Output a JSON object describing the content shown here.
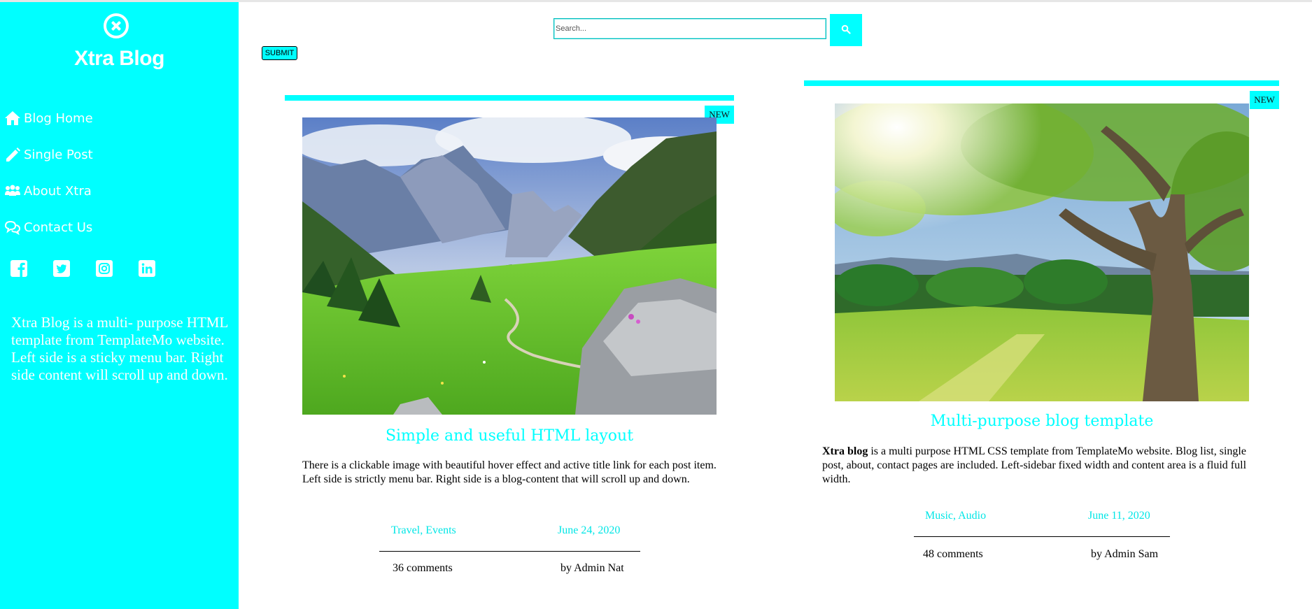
{
  "sidebar": {
    "brand": "Xtra Blog",
    "nav": [
      {
        "label": "Blog Home",
        "icon": "home-icon"
      },
      {
        "label": "Single Post",
        "icon": "pencil-icon"
      },
      {
        "label": "About Xtra",
        "icon": "users-icon"
      },
      {
        "label": "Contact Us",
        "icon": "comments-icon"
      }
    ],
    "social": [
      "facebook-icon",
      "twitter-icon",
      "instagram-icon",
      "linkedin-icon"
    ],
    "description": "Xtra Blog is a multi- purpose HTML template from TemplateMo website. Left side is a sticky menu bar. Right side content will scroll up and down."
  },
  "search": {
    "placeholder": "Search...",
    "button_icon": "search-icon",
    "submit_label": "SUBMIT"
  },
  "posts": [
    {
      "badge": "NEW",
      "image": "mountain valley",
      "title": "Simple and useful HTML layout",
      "body": "There is a clickable image with beautiful hover effect and active title link for each post item. Left side is strictly menu bar. Right side is a blog-content that will scroll up and down.",
      "category": "Travel, Events",
      "date": "June 24, 2020",
      "comments": "36 comments",
      "author": "by Admin Nat"
    },
    {
      "badge": "NEW",
      "image": "sunny tree meadow",
      "title": "Multi-purpose blog template",
      "body_bold": "Xtra blog",
      "body": " is a multi purpose HTML CSS template from TemplateMo website. Blog list, single post, about, contact pages are included. Left-sidebar fixed width and content area is a fluid full width.",
      "category": "Music, Audio",
      "date": "June 11, 2020",
      "comments": "48 comments",
      "author": "by Admin Sam"
    }
  ],
  "colors": {
    "accent": "#00ffff",
    "text": "#000000",
    "sidebar_text": "#ffffff"
  }
}
